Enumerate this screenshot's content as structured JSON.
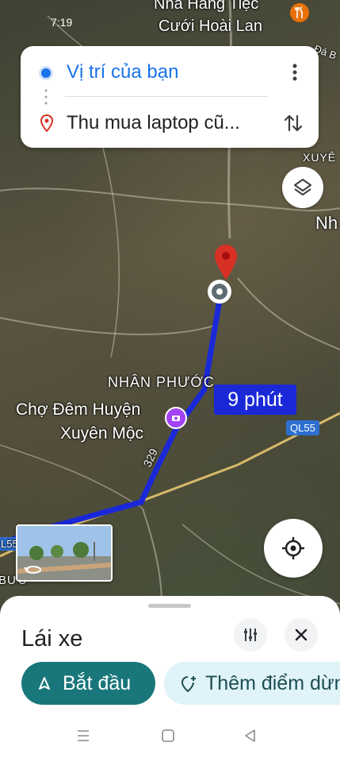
{
  "status_bar": {
    "time": "7:19"
  },
  "map": {
    "labels": {
      "restaurant_line1": "Nhà Hàng Tiệc",
      "restaurant_line2": "Cưới Hoài Lan",
      "corner_top_right": "Đá B",
      "xuye": "XUYÊ",
      "nh": "Nh",
      "nhan_phuoc": "NHÂN PHƯỚC",
      "market_line1": "Chợ Đêm Huyện",
      "market_line2": "Xuyên Mộc",
      "road_329": "329",
      "ql55_left": "L55",
      "buu": "BƯU"
    },
    "route_time": "9 phút",
    "highway_badge": "QL55",
    "route_color": "#1a28d8"
  },
  "directions": {
    "origin": "Vị trí của bạn",
    "destination": "Thu mua laptop cũ..."
  },
  "bottom_sheet": {
    "travel_mode": "Lái xe",
    "start_label": "Bắt đầu",
    "add_stop_label": "Thêm điểm dừng"
  },
  "colors": {
    "accent_blue": "#1a73e8",
    "start_button": "#19777b",
    "add_stop_bg": "#dff3f8",
    "destination_pin": "#d93025"
  },
  "icons": {
    "origin": "blue-dot-icon",
    "destination": "location-pin-icon",
    "more": "more-vert-icon",
    "swap": "swap-vert-icon",
    "layers": "layers-icon",
    "locate": "my-location-icon",
    "filter": "tune-icon",
    "close": "close-icon",
    "start": "navigation-arrow-icon",
    "add_stop": "add-location-icon"
  }
}
